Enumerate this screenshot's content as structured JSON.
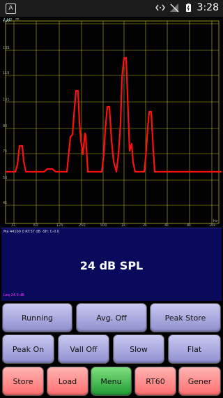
{
  "status_bar": {
    "notification_glyph": "A",
    "time": "3:28",
    "icons": [
      "code-arrows-icon",
      "no-signal-icon",
      "battery-charging-icon"
    ]
  },
  "graph": {
    "top_label": "2 Hz",
    "top_superscript": "dB",
    "y_ticks": [
      "145",
      "135",
      "115",
      "101",
      "86",
      "71",
      "56",
      "41"
    ],
    "x_ticks": [
      "31",
      "63",
      "125",
      "250",
      "500",
      "1k",
      "2k",
      "4k",
      "8k",
      "16k"
    ],
    "x_unit": "Hz",
    "grid_color": "#b8b820",
    "trace_color": "#ff1010",
    "axis_label_color": "#9adbdb"
  },
  "info": {
    "status_line": "Ma 44100 0 RT:57 dB -SH: C-0.0",
    "spl_text": "24 dB SPL",
    "leq_text": "Leq 24.0 dB"
  },
  "buttons": {
    "row1": [
      "Running",
      "Avg. Off",
      "Peak Store"
    ],
    "row2": [
      "Peak On",
      "Vall Off",
      "Slow",
      "Flat"
    ],
    "row3": [
      "Store",
      "Load",
      "Menu",
      "RT60",
      "Gener"
    ]
  }
}
